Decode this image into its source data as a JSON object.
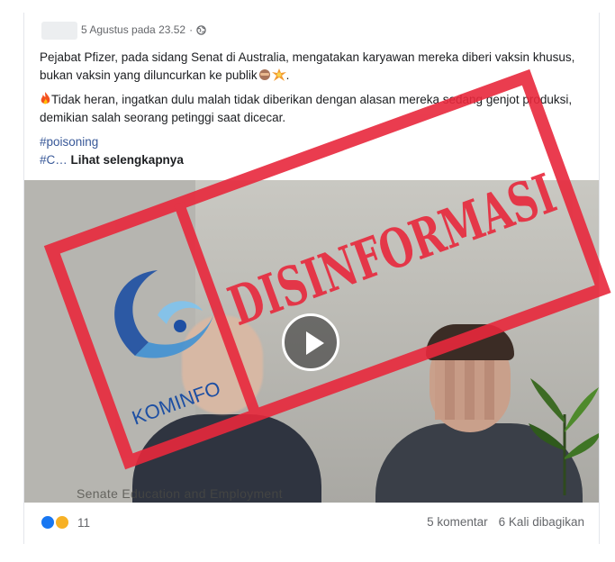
{
  "post": {
    "timestamp": "5 Agustus pada 23.52",
    "separator": "·",
    "audience_icon": "globe-icon",
    "paragraph1": "Pejabat Pfizer, pada sidang Senat di Australia, mengatakan karyawan mereka diberi vaksin khusus, bukan vaksin yang diluncurkan ke publik",
    "paragraph1_end": ".",
    "paragraph2": "Tidak heran, ingatkan dulu malah tidak diberikan dengan alasan mereka sedang genjot produksi, demikian salah seorang petinggi saat dicecar.",
    "hashtag1": "#poisoning",
    "hashtag2": "#C…",
    "see_more": "Lihat selengkapnya"
  },
  "video": {
    "caption": "Senate Education and Employment",
    "stamp_text": "DISINFORMASI",
    "stamp_color": "#e8283c",
    "logo_text": "KOMINFO",
    "logo_color": "#1d4fa3",
    "play_icon": "play-icon"
  },
  "footer": {
    "reaction_icons": [
      "like-icon",
      "wow-icon"
    ],
    "reaction_count": "11",
    "comments": "5 komentar",
    "shares": "6 Kali dibagikan"
  }
}
